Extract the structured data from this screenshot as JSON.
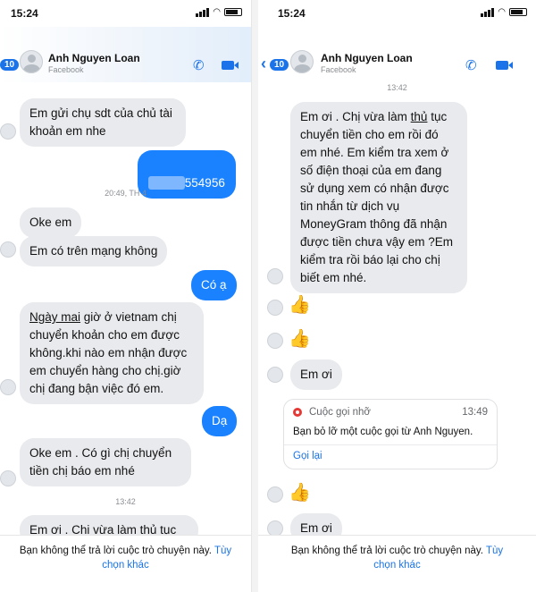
{
  "status": {
    "time": "15:24"
  },
  "contact": {
    "name": "Anh Nguyen Loan",
    "source": "Facebook",
    "unread_badge": "10"
  },
  "left": {
    "messages": [
      {
        "dir": "in",
        "text": "Em gửi chụ sdt của chủ tài\nkhoản em nhe"
      },
      {
        "dir": "out",
        "text": "554956",
        "masked_prefix": true
      },
      {
        "stamp": "20:49, TH 4"
      },
      {
        "dir": "in",
        "text": "Oke em"
      },
      {
        "dir": "in",
        "text": "Em có trên mạng không"
      },
      {
        "dir": "out",
        "text": "Có ạ"
      },
      {
        "dir": "in",
        "text_prefix": "Ngày mai",
        "text": " giờ ở vietnam chị\nchuyển khoản cho em được\nkhông.khi nào em nhận được\nem chuyển hàng cho chị.giờ\nchị đang bận việc đó em."
      },
      {
        "dir": "out",
        "text": "Dạ"
      },
      {
        "dir": "in",
        "text": "Oke em . Có gì chị chuyển\ntiền chị báo em nhé"
      },
      {
        "stamp": "13:42"
      },
      {
        "dir": "in",
        "text": "Em ơi . Chị vừa làm thủ tục"
      }
    ]
  },
  "right": {
    "stamp_top": "13:42",
    "long_message_prefix": "Em ơi . Chị vừa làm ",
    "long_message_underlined": "thủ",
    "long_message_rest": " tục\nchuyển tiền cho em rồi đó\nem nhé. Em kiểm tra xem ở\nsố điện thoại của em đang\nsử dụng xem có nhận được\ntin nhắn từ dịch vụ\nMoneyGram thông đã nhận\nđược tiền chưa vậy em ?Em\nkiểm tra rồi báo lại cho chị\nbiết em nhé.",
    "em_oi_1": "Em ơi",
    "missed_call": {
      "title": "Cuộc gọi nhỡ",
      "time": "13:49",
      "body": "Bạn bỏ lỡ một cuộc gọi từ Anh Nguyen.",
      "action": "Gọi lại"
    },
    "em_oi_2": "Em ơi"
  },
  "footer": {
    "text": "Bạn không thể trả lời cuộc trò chuyện này.",
    "link_1": "Tùy",
    "link_2": "chọn khác"
  },
  "colors": {
    "accent": "#1a82ff",
    "bubble_in": "#e9eaed",
    "missed": "#e53935"
  },
  "icons": [
    "back-icon",
    "phone-icon",
    "video-icon",
    "like-icon",
    "missed-call-icon",
    "avatar-icon"
  ]
}
